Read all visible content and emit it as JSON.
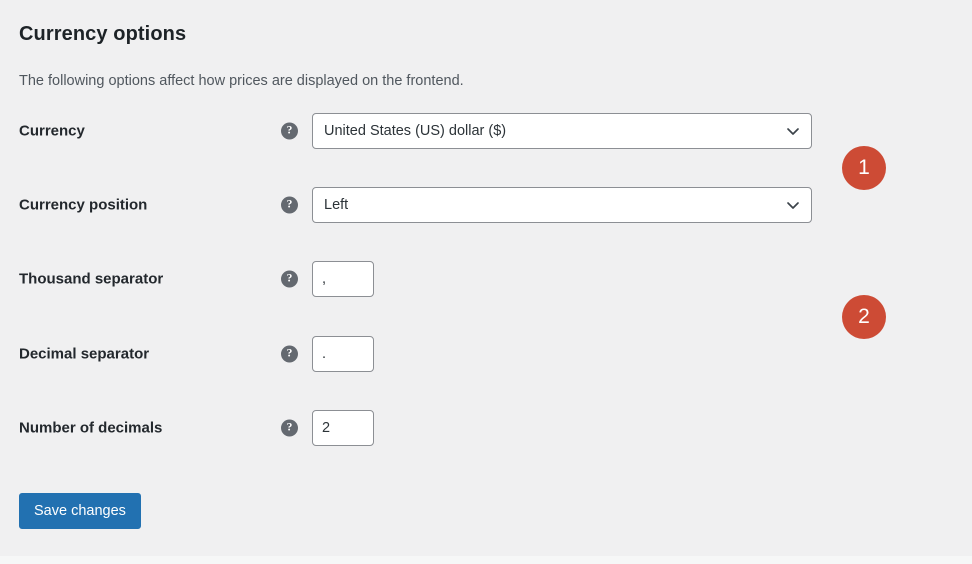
{
  "page": {
    "title": "Currency options",
    "description": "The following options affect how prices are displayed on the frontend.",
    "background_color": "#f0f0f1"
  },
  "form": {
    "help_icon_glyph": "?",
    "rows": [
      {
        "label": "Currency",
        "control": "select",
        "value": "United States (US) dollar ($)",
        "help_icon": "help-icon"
      },
      {
        "label": "Currency position",
        "control": "select",
        "value": "Left",
        "help_icon": "help-icon"
      },
      {
        "label": "Thousand separator",
        "control": "text",
        "value": ",",
        "help_icon": "help-icon"
      },
      {
        "label": "Decimal separator",
        "control": "text",
        "value": ".",
        "help_icon": "help-icon"
      },
      {
        "label": "Number of decimals",
        "control": "text",
        "value": "2",
        "help_icon": "help-icon"
      }
    ]
  },
  "actions": {
    "save_label": "Save changes",
    "save_color": "#2271b1"
  },
  "annotations": {
    "color": "#cd4b35",
    "badges": [
      {
        "number": "1"
      },
      {
        "number": "2"
      }
    ]
  }
}
